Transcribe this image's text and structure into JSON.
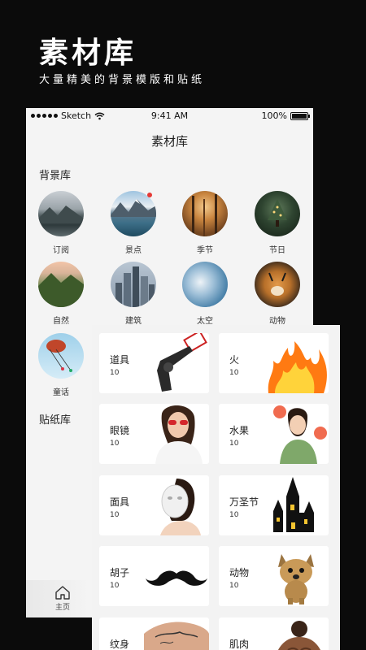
{
  "hero": {
    "title": "素材库",
    "subtitle": "大量精美的背景模版和贴纸"
  },
  "status": {
    "carrier": "Sketch",
    "time": "9:41 AM",
    "battery": "100%"
  },
  "nav": {
    "title": "素材库"
  },
  "background_library": {
    "title": "背景库",
    "items": [
      {
        "label": "订阅",
        "icon": "mountain-lake-thumbnail"
      },
      {
        "label": "景点",
        "icon": "scenic-lake-thumbnail",
        "badge": true
      },
      {
        "label": "季节",
        "icon": "autumn-forest-thumbnail"
      },
      {
        "label": "节日",
        "icon": "festival-tree-thumbnail"
      },
      {
        "label": "自然",
        "icon": "nature-mountain-thumbnail"
      },
      {
        "label": "建筑",
        "icon": "city-buildings-thumbnail"
      },
      {
        "label": "太空",
        "icon": "sky-clouds-thumbnail"
      },
      {
        "label": "动物",
        "icon": "tiger-thumbnail"
      },
      {
        "label": "童话",
        "icon": "fairytale-swing-thumbnail"
      }
    ]
  },
  "sticker_library": {
    "title": "贴纸库",
    "items": [
      {
        "name": "道具",
        "count": "10",
        "icon": "gun-prop-sticker"
      },
      {
        "name": "火",
        "count": "10",
        "icon": "fire-sticker"
      },
      {
        "name": "眼镜",
        "count": "10",
        "icon": "glasses-sticker"
      },
      {
        "name": "水果",
        "count": "10",
        "icon": "fruit-sticker"
      },
      {
        "name": "面具",
        "count": "10",
        "icon": "mask-sticker"
      },
      {
        "name": "万圣节",
        "count": "10",
        "icon": "halloween-castle-sticker"
      },
      {
        "name": "胡子",
        "count": "10",
        "icon": "mustache-sticker"
      },
      {
        "name": "动物",
        "count": "10",
        "icon": "dog-sticker"
      },
      {
        "name": "纹身",
        "count": "",
        "icon": "tattoo-sticker"
      },
      {
        "name": "肌肉",
        "count": "",
        "icon": "muscle-sticker"
      }
    ]
  },
  "tabbar": {
    "home_label": "主页"
  }
}
